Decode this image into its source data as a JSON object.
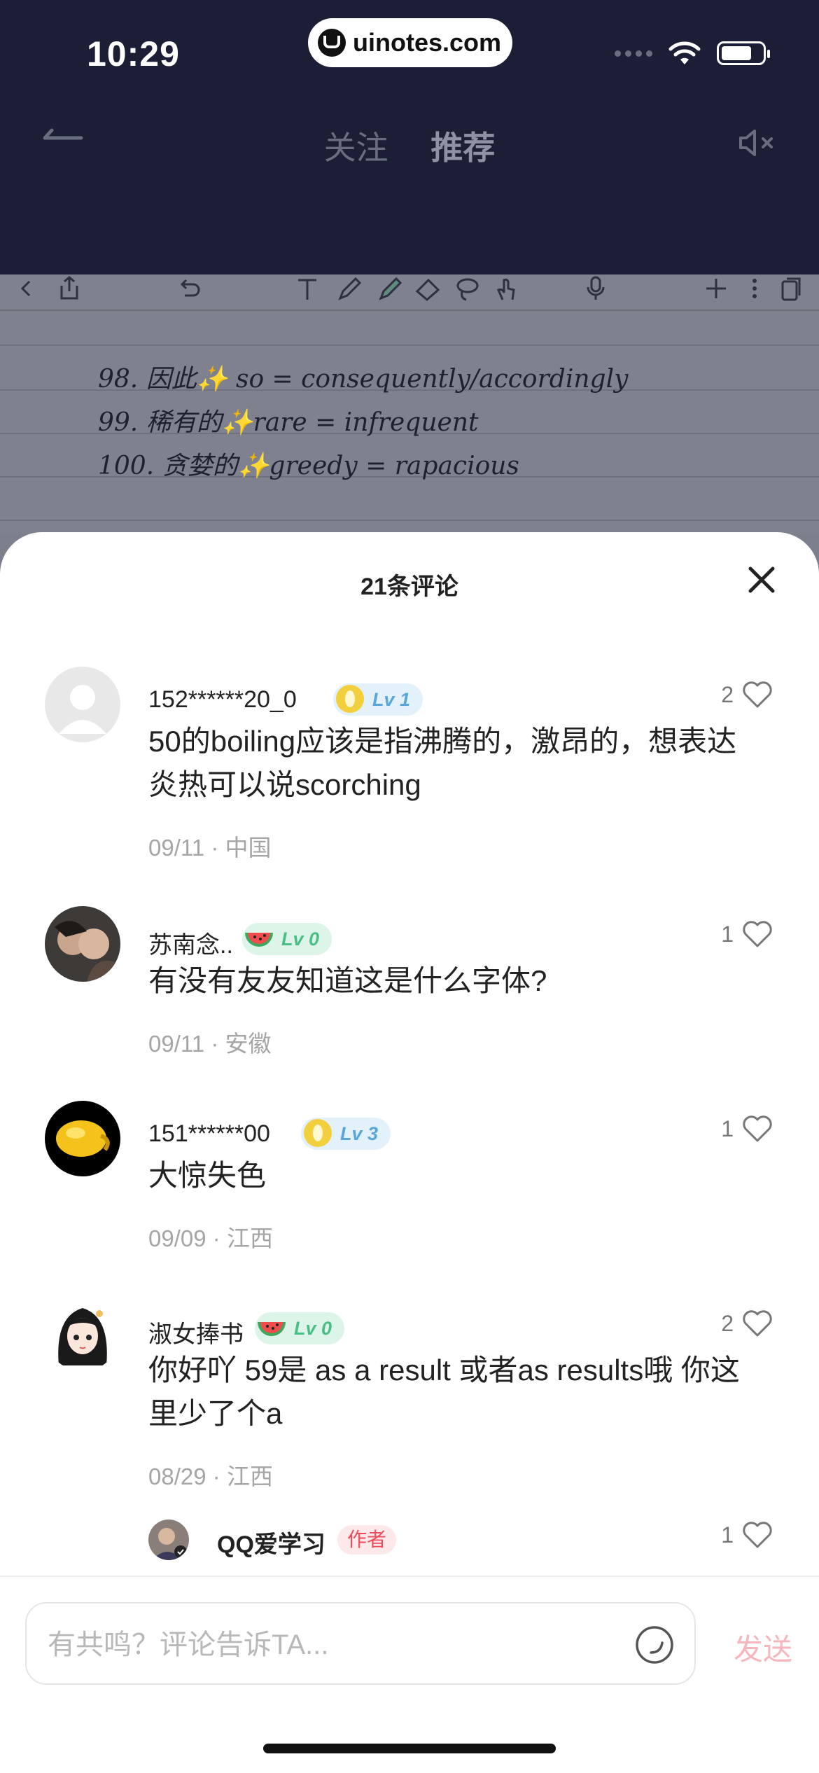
{
  "status_bar": {
    "time": "10:29",
    "site": "uinotes.com"
  },
  "nav": {
    "tab_follow": "关注",
    "tab_recommend": "推荐"
  },
  "note": {
    "rows": [
      "98. 因此✨ so = consequently/accordingly",
      "99. 稀有的✨rare = infrequent",
      "100. 贪婪的✨greedy = rapacious"
    ]
  },
  "sheet": {
    "title": "21条评论",
    "comments": [
      {
        "user": "152******20_0",
        "level": "Lv 1",
        "likes": "2",
        "text": "50的boiling应该是指沸腾的，激昂的，想表达炎热可以说scorching",
        "date": "09/11",
        "location": "中国"
      },
      {
        "user": "苏南念..",
        "level": "Lv 0",
        "likes": "1",
        "text": "有没有友友知道这是什么字体?",
        "date": "09/11",
        "location": "安徽"
      },
      {
        "user": "151******00",
        "level": "Lv 3",
        "likes": "1",
        "text": "大惊失色",
        "date": "09/09",
        "location": "江西"
      },
      {
        "user": "淑女捧书",
        "level": "Lv 0",
        "likes": "2",
        "text": "你好吖  59是 as a result 或者as results哦 你这里少了个a",
        "date": "08/29",
        "location": "江西"
      }
    ],
    "reply": {
      "user": "QQ爱学习",
      "tag": "作者",
      "likes": "1"
    },
    "separator": "·"
  },
  "input": {
    "placeholder": "有共鸣？评论告诉TA...",
    "send_label": "发送"
  },
  "colors": {
    "header_bg": "#1b1e34",
    "send_disabled": "#f6b6bd",
    "author_tag": "#ef4b5a"
  }
}
